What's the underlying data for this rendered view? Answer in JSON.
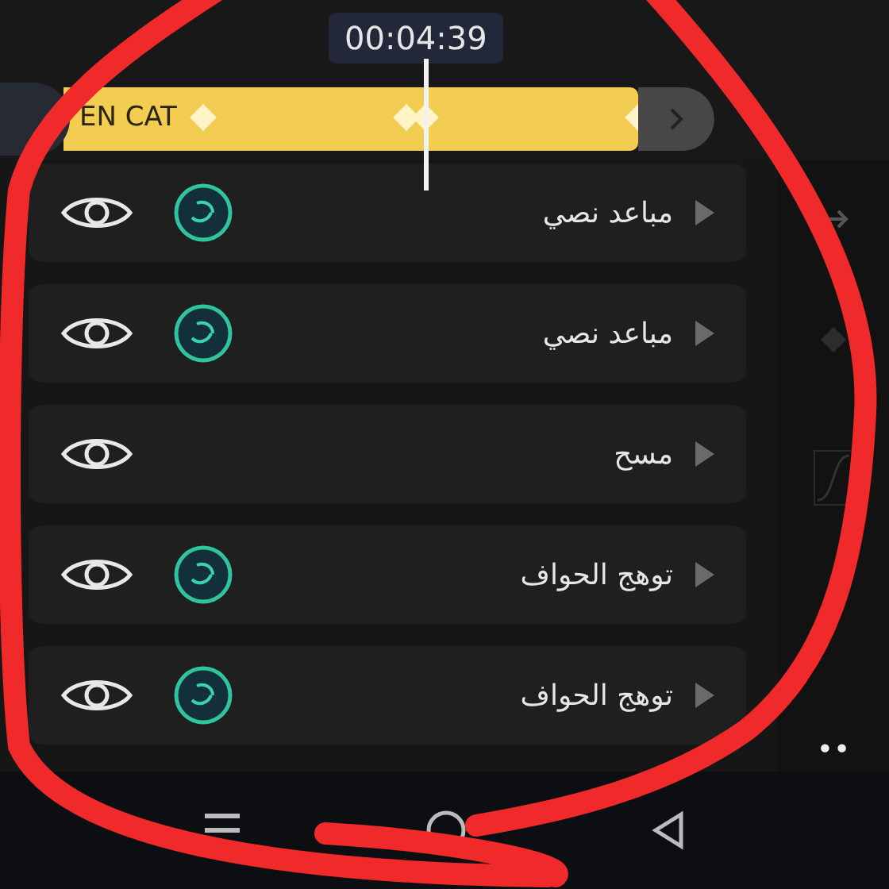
{
  "timeline": {
    "timecode": "00:04:39",
    "clip": {
      "label": "EN CAT"
    }
  },
  "layers": [
    {
      "label": "مباعد نصي",
      "kind": "effect"
    },
    {
      "label": "مباعد نصي",
      "kind": "effect"
    },
    {
      "label": "مسح",
      "kind": "plain"
    },
    {
      "label": "توهج الحواف",
      "kind": "effect"
    },
    {
      "label": "توهج الحواف",
      "kind": "effect"
    }
  ],
  "side_panel": {
    "more": "••"
  },
  "nav_bar": {
    "buttons": [
      {
        "kind": "menu"
      },
      {
        "kind": "home"
      },
      {
        "kind": "back"
      }
    ]
  }
}
